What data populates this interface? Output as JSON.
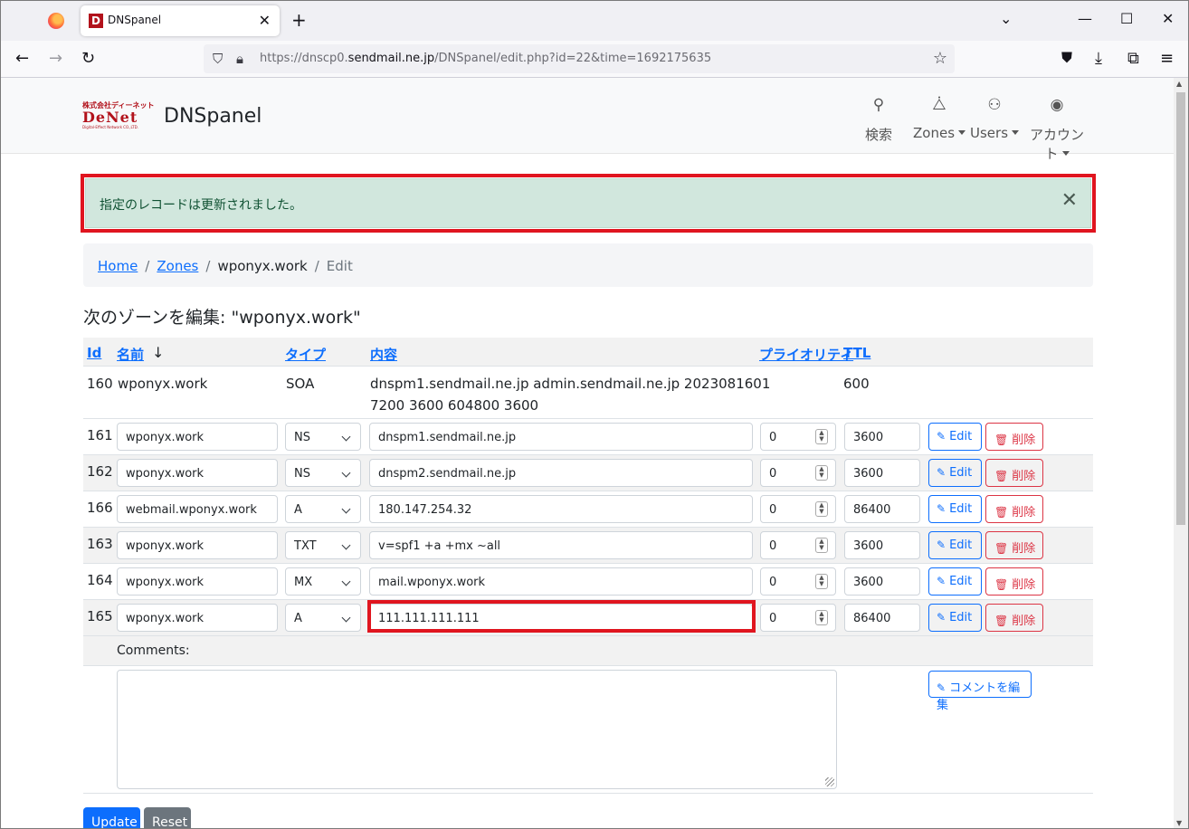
{
  "browser": {
    "tab_title": "DNSpanel",
    "tab_favicon_letter": "D",
    "url_prefix": "https://dnscp0.",
    "url_domain": "sendmail.ne.jp",
    "url_path": "/DNSpanel/edit.php?id=22&time=1692175635"
  },
  "header": {
    "logo_top": "株式会社ディーネット",
    "logo_mid": "DeNet",
    "logo_bottom": "Digital-Effect Network CO.,LTD.",
    "brand": "DNSpanel",
    "nav": [
      {
        "icon": "search-icon",
        "label": "検索"
      },
      {
        "icon": "sitemap-icon",
        "label": "Zones"
      },
      {
        "icon": "users-icon",
        "label": "Users"
      },
      {
        "icon": "account-icon",
        "label": "アカウント"
      }
    ]
  },
  "alert": {
    "text": "指定のレコードは更新されました。"
  },
  "breadcrumb": {
    "home": "Home",
    "zones": "Zones",
    "zone": "wponyx.work",
    "current": "Edit"
  },
  "page_title": "次のゾーンを編集: \"wponyx.work\"",
  "table": {
    "headers": {
      "id": "Id",
      "name": "名前",
      "type": "タイプ",
      "content": "内容",
      "priority": "プライオリティ",
      "ttl": "TTL"
    },
    "sort_arrow": "↓",
    "soa": {
      "id": "160",
      "name": "wponyx.work",
      "type": "SOA",
      "content_line1": "dnspm1.sendmail.ne.jp admin.sendmail.ne.jp 2023081601",
      "content_line2": "7200 3600 604800 3600",
      "ttl": "600"
    },
    "records": [
      {
        "id": "161",
        "name": "wponyx.work",
        "type": "NS",
        "content": "dnspm1.sendmail.ne.jp",
        "priority": "0",
        "ttl": "3600"
      },
      {
        "id": "162",
        "name": "wponyx.work",
        "type": "NS",
        "content": "dnspm2.sendmail.ne.jp",
        "priority": "0",
        "ttl": "3600"
      },
      {
        "id": "166",
        "name": "webmail.wponyx.work",
        "type": "A",
        "content": "180.147.254.32",
        "priority": "0",
        "ttl": "86400"
      },
      {
        "id": "163",
        "name": "wponyx.work",
        "type": "TXT",
        "content": "v=spf1 +a +mx ~all",
        "priority": "0",
        "ttl": "3600"
      },
      {
        "id": "164",
        "name": "wponyx.work",
        "type": "MX",
        "content": "mail.wponyx.work",
        "priority": "0",
        "ttl": "3600"
      },
      {
        "id": "165",
        "name": "wponyx.work",
        "type": "A",
        "content": "111.111.111.111",
        "priority": "0",
        "ttl": "86400"
      }
    ],
    "edit_label": "Edit",
    "delete_label": "削除"
  },
  "comments": {
    "label": "Comments:",
    "value": "",
    "edit_button": "コメントを編集"
  },
  "actions": {
    "update": "Update",
    "reset": "Reset"
  },
  "colors": {
    "primary": "#0d6efd",
    "danger": "#dc3545",
    "success_bg": "#d1e7dd",
    "highlight": "#e0151f"
  }
}
